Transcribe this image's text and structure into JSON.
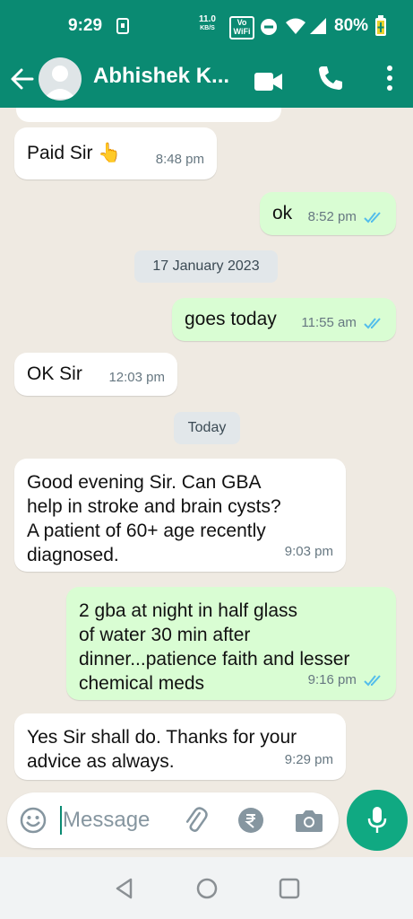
{
  "status": {
    "time": "9:29",
    "net_speed": "11.0",
    "net_unit": "KB/S",
    "wifi_badge_top": "Vo",
    "wifi_badge_bottom": "WiFi",
    "battery": "80%"
  },
  "header": {
    "contact_name": "Abhishek K..."
  },
  "messages": [
    {
      "text_lines": [
        "Paid Sir 👆"
      ],
      "time": "8:48 pm",
      "dir": "in"
    },
    {
      "text_lines": [
        "ok"
      ],
      "time": "8:52 pm",
      "dir": "out"
    },
    {
      "date": "17 January 2023"
    },
    {
      "text_lines": [
        "goes today"
      ],
      "time": "11:55 am",
      "dir": "out"
    },
    {
      "text_lines": [
        "OK Sir"
      ],
      "time": "12:03 pm",
      "dir": "in"
    },
    {
      "date": "Today"
    },
    {
      "text_lines": [
        "Good evening Sir. Can GBA",
        "help in stroke and brain cysts?",
        "A patient of 60+ age recently",
        "diagnosed."
      ],
      "time": "9:03 pm",
      "dir": "in"
    },
    {
      "text_lines": [
        "2 gba at night in half glass",
        "of water 30 min after",
        "dinner...patience faith and lesser",
        "chemical meds"
      ],
      "time": "9:16 pm",
      "dir": "out"
    },
    {
      "text_lines": [
        "Yes Sir shall do. Thanks for your",
        "advice as always."
      ],
      "time": "9:29 pm",
      "dir": "in"
    }
  ],
  "composer": {
    "placeholder": "Message"
  },
  "colors": {
    "header": "#0a8a72",
    "outgoing_bubble": "#d9fdd3",
    "incoming_bubble": "#ffffff",
    "read_ticks": "#53bdeb",
    "mic_button": "#10a982"
  },
  "icons": [
    "back-arrow-icon",
    "video-call-icon",
    "phone-icon",
    "more-vertical-icon",
    "emoji-icon",
    "attach-icon",
    "rupee-payment-icon",
    "camera-icon",
    "mic-icon",
    "nav-back-icon",
    "nav-home-icon",
    "nav-recents-icon"
  ]
}
